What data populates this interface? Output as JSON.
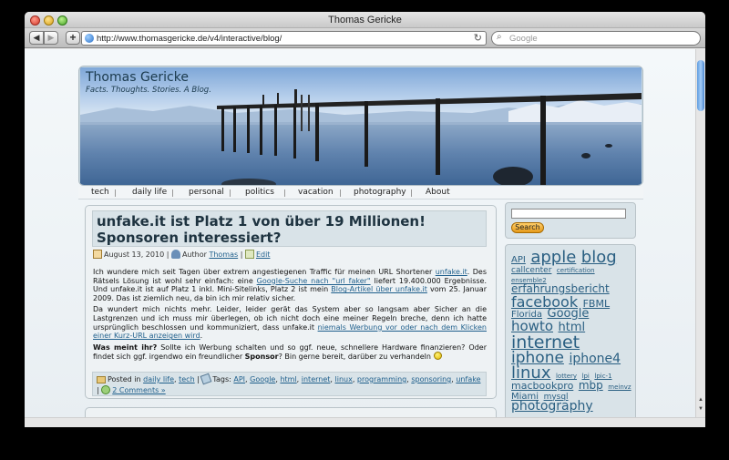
{
  "window": {
    "title": "Thomas Gericke"
  },
  "browser": {
    "url": "http://www.thomasgericke.de/v4/interactive/blog/",
    "search_placeholder": "Google"
  },
  "site": {
    "title": "Thomas Gericke",
    "tagline": "Facts. Thoughts. Stories. A Blog."
  },
  "menu": [
    "tech",
    "daily life",
    "personal",
    "politics",
    "vacation",
    "photography",
    "About"
  ],
  "post": {
    "title": "unfake.it ist Platz 1 von über 19 Millionen! Sponsoren interessiert?",
    "date": "August 13, 2010",
    "author_label": "Author",
    "author": "Thomas",
    "edit": "Edit",
    "p1_a": "Ich wundere mich seit Tagen über extrem angestiegenen Traffic für meinen URL Shortener ",
    "p1_link1": "unfake.it",
    "p1_b": ". Des Rätsels Lösung ist wohl sehr einfach: eine ",
    "p1_link2": "Google-Suche nach \"url faker\"",
    "p1_c": " liefert 19.400.000 Ergebnisse. Und unfake.it ist auf Platz 1 inkl. Mini-Sitelinks, Platz 2 ist mein ",
    "p1_link3": "Blog-Artikel über unfake.it",
    "p1_d": " vom 25. Januar 2009. Das ist ziemlich neu, da bin ich mir relativ sicher.",
    "p2_a": "Da wundert mich nichts mehr. Leider, leider gerät das System aber so langsam aber Sicher an die Lastgrenzen und ich muss mir überlegen, ob ich nicht doch eine meiner Regeln breche, denn ich hatte ursprünglich beschlossen und kommuniziert, dass unfake.it ",
    "p2_link": "niemals Werbung vor oder nach dem Klicken einer Kurz-URL anzeigen wird",
    "p2_b": ".",
    "p3_bold": "Was meint ihr?",
    "p3_a": " Sollte ich Werbung schalten und so ggf. neue, schnellere Hardware finanzieren? Oder findet sich ggf. irgendwo ein freundlicher ",
    "p3_bold2": "Sponsor",
    "p3_b": "? Bin gerne bereit, darüber zu verhandeln",
    "posted_in": "Posted in",
    "categories": [
      "daily life",
      "tech"
    ],
    "tags_label": "Tags:",
    "tags": [
      "API",
      "Google",
      "html",
      "internet",
      "linux",
      "programming",
      "sponsoring",
      "unfake"
    ],
    "comments": "2 Comments »"
  },
  "sidebar": {
    "search_button": "Search",
    "tags": [
      {
        "t": "API",
        "s": 10
      },
      {
        "t": "apple",
        "s": 18
      },
      {
        "t": "blog",
        "s": 18
      },
      {
        "t": "callcenter",
        "s": 9
      },
      {
        "t": "certification",
        "s": 7
      },
      {
        "t": "ensemble2",
        "s": 7
      },
      {
        "t": "erfahrungsbericht",
        "s": 12
      },
      {
        "t": "facebook",
        "s": 16
      },
      {
        "t": "FBML",
        "s": 11
      },
      {
        "t": "Florida",
        "s": 10
      },
      {
        "t": "Google",
        "s": 13
      },
      {
        "t": "howto",
        "s": 15
      },
      {
        "t": "html",
        "s": 13
      },
      {
        "t": "internet",
        "s": 19
      },
      {
        "t": "iphone",
        "s": 17
      },
      {
        "t": "iphone4",
        "s": 14
      },
      {
        "t": "linux",
        "s": 18
      },
      {
        "t": "lottery",
        "s": 7
      },
      {
        "t": "lpi",
        "s": 7
      },
      {
        "t": "lpic-1",
        "s": 7
      },
      {
        "t": "macbookpro",
        "s": 11
      },
      {
        "t": "mbp",
        "s": 12
      },
      {
        "t": "meinvz",
        "s": 7
      },
      {
        "t": "Miami",
        "s": 10
      },
      {
        "t": "mysql",
        "s": 9
      },
      {
        "t": "photography",
        "s": 14
      }
    ]
  }
}
